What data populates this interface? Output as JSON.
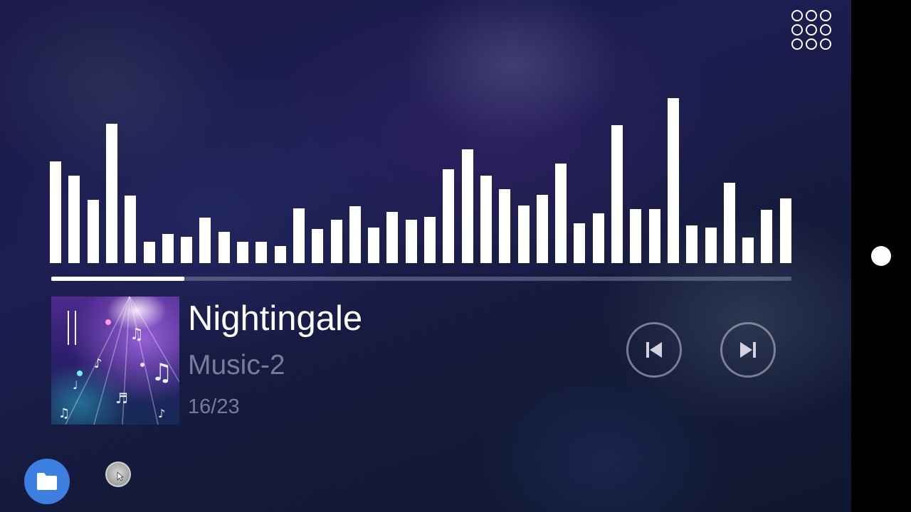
{
  "colors": {
    "accent_folder": "#3c7fe0",
    "text_primary": "#ffffff",
    "text_secondary": "#8f93a8"
  },
  "menu": {
    "icon": "grid-menu-icon"
  },
  "track": {
    "title": "Nightingale",
    "album": "Music-2",
    "position": "16/23",
    "progress_fraction": 0.18
  },
  "controls": {
    "previous_icon": "skip-previous-icon",
    "next_icon": "skip-next-icon"
  },
  "dock": {
    "folder_icon": "folder-icon"
  },
  "visualizer": {
    "max_level": 232,
    "levels": [
      143,
      123,
      89,
      196,
      95,
      30,
      41,
      37,
      64,
      44,
      30,
      30,
      24,
      77,
      48,
      61,
      80,
      50,
      72,
      61,
      65,
      132,
      160,
      123,
      104,
      81,
      96,
      140,
      56,
      70,
      194,
      76,
      76,
      232,
      53,
      50,
      113,
      36,
      75,
      91
    ]
  }
}
